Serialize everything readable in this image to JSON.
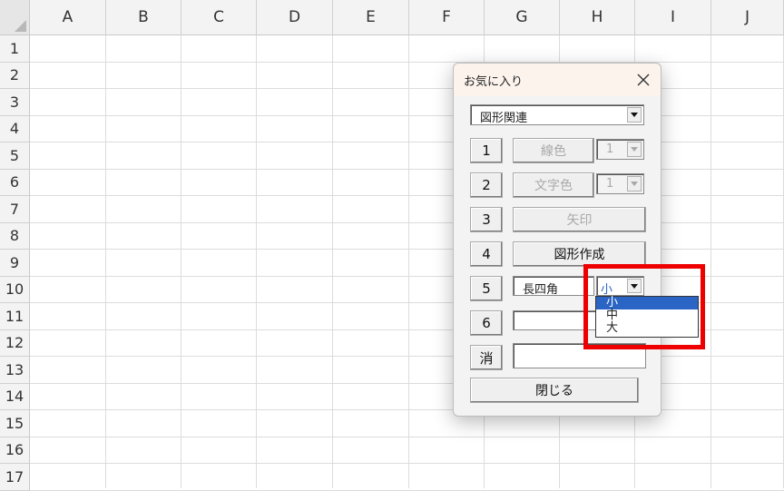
{
  "sheet": {
    "columns": [
      "A",
      "B",
      "C",
      "D",
      "E",
      "F",
      "G",
      "H",
      "I",
      "J"
    ],
    "rows": [
      "1",
      "2",
      "3",
      "4",
      "5",
      "6",
      "7",
      "8",
      "9",
      "10",
      "11",
      "12",
      "13",
      "14",
      "15",
      "16",
      "17"
    ]
  },
  "dialog": {
    "title": "お気に入り",
    "category_select": "図形関連",
    "rows": [
      {
        "num": "1",
        "action": "線色",
        "combo": "1"
      },
      {
        "num": "2",
        "action": "文字色",
        "combo": "1"
      },
      {
        "num": "3",
        "action": "矢印"
      },
      {
        "num": "4",
        "action": "図形作成"
      },
      {
        "num": "5",
        "shape_select": "長四角",
        "size_select": "小"
      },
      {
        "num": "6"
      },
      {
        "num": "消"
      }
    ],
    "close_label": "閉じる",
    "size_options": [
      "小",
      "中",
      "大"
    ],
    "selected_size": "小"
  },
  "colors": {
    "highlight": "#ee0000",
    "selection": "#2a64c4"
  }
}
